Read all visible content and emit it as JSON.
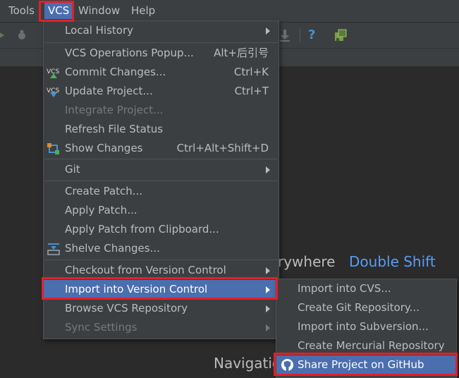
{
  "menubar": {
    "items": [
      {
        "label": "Tools"
      },
      {
        "label": "VCS"
      },
      {
        "label": "Window"
      },
      {
        "label": "Help"
      }
    ]
  },
  "toolbar": {
    "icons": [
      "run-icon",
      "debug-icon",
      "download-icon",
      "help-icon",
      "android-sdk-icon"
    ],
    "help_glyph": "?"
  },
  "editor": {
    "hint1_text": "rywhere",
    "hint1_key": "Double Shift",
    "hint2_text": "Navigatio"
  },
  "vcs_menu": {
    "items": [
      {
        "label": "Local History",
        "has_submenu": true
      },
      {
        "label": "VCS Operations Popup...",
        "shortcut": "Alt+后引号"
      },
      {
        "label": "Commit Changes...",
        "shortcut": "Ctrl+K",
        "icon": "vcs-commit-icon",
        "icon_text": "VCS"
      },
      {
        "label": "Update Project...",
        "shortcut": "Ctrl+T",
        "icon": "vcs-update-icon",
        "icon_text": "VCS"
      },
      {
        "label": "Integrate Project...",
        "disabled": true
      },
      {
        "label": "Refresh File Status"
      },
      {
        "label": "Show Changes",
        "shortcut": "Ctrl+Alt+Shift+D",
        "icon": "show-changes-icon"
      },
      {
        "label": "Git",
        "has_submenu": true
      },
      {
        "label": "Create Patch..."
      },
      {
        "label": "Apply Patch..."
      },
      {
        "label": "Apply Patch from Clipboard..."
      },
      {
        "label": "Shelve Changes...",
        "icon": "shelve-icon"
      },
      {
        "label": "Checkout from Version Control",
        "has_submenu": true
      },
      {
        "label": "Import into Version Control",
        "has_submenu": true,
        "selected": true
      },
      {
        "label": "Browse VCS Repository",
        "has_submenu": true
      },
      {
        "label": "Sync Settings",
        "has_submenu": true,
        "disabled": true
      }
    ]
  },
  "import_submenu": {
    "items": [
      {
        "label": "Import into CVS..."
      },
      {
        "label": "Create Git Repository..."
      },
      {
        "label": "Import into Subversion..."
      },
      {
        "label": "Create Mercurial Repository"
      },
      {
        "label": "Share Project on GitHub",
        "selected": true,
        "icon": "github-icon"
      }
    ]
  },
  "colors": {
    "background": "#2b2b2b",
    "panel": "#3c3f41",
    "selection": "#4b6eaf",
    "highlight_box": "#e0202a",
    "link_blue": "#589df6"
  }
}
